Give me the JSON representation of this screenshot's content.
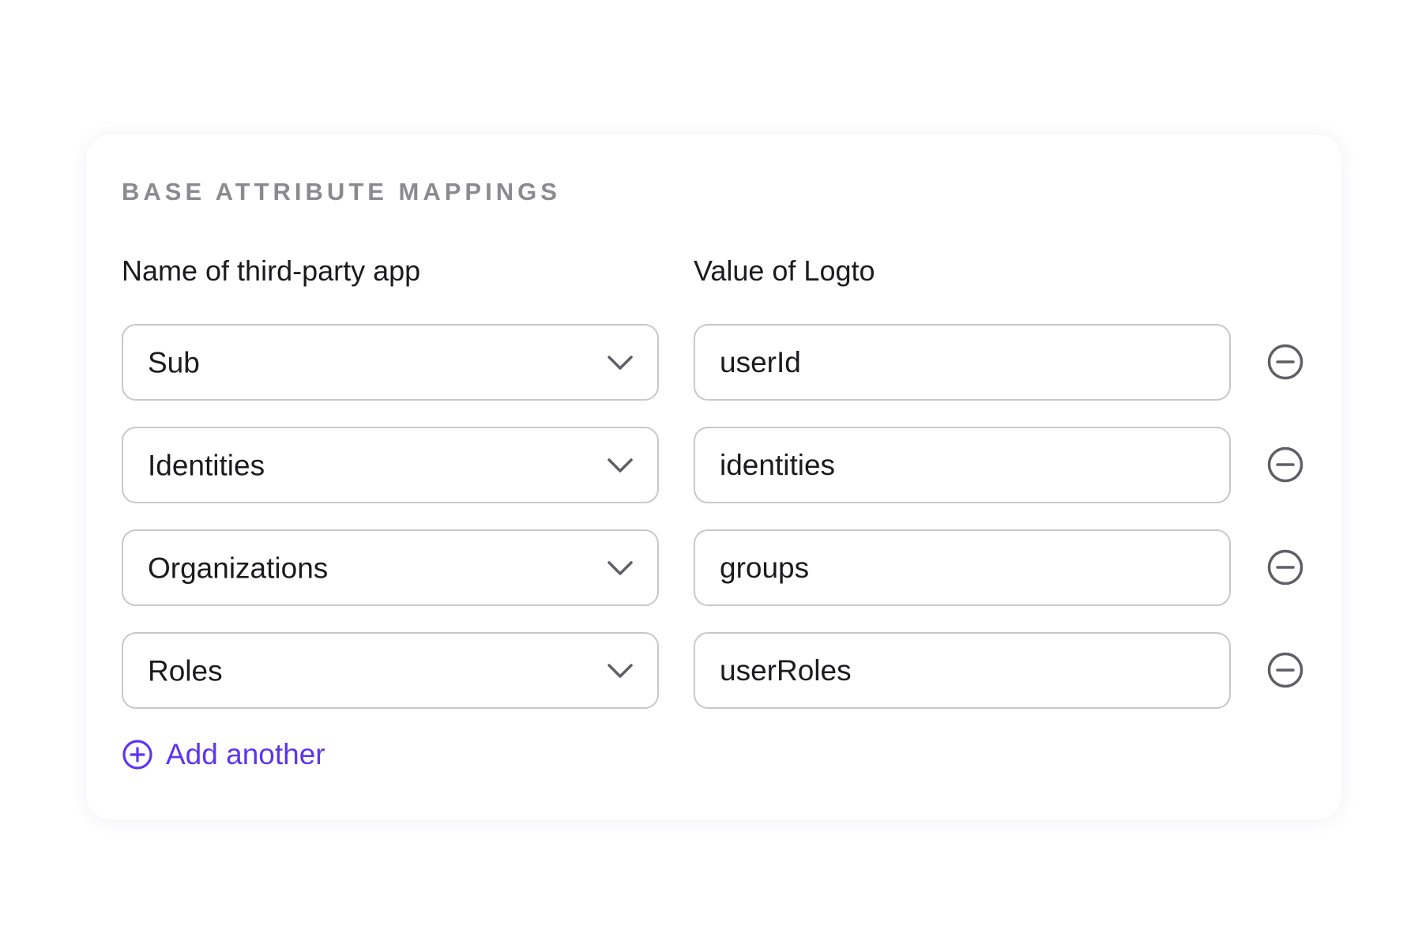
{
  "section": {
    "title": "BASE ATTRIBUTE MAPPINGS"
  },
  "columns": {
    "left_header": "Name of third-party app",
    "right_header": "Value of Logto"
  },
  "mappings": [
    {
      "third_party": "Sub",
      "logto_value": "userId"
    },
    {
      "third_party": "Identities",
      "logto_value": "identities"
    },
    {
      "third_party": "Organizations",
      "logto_value": "groups"
    },
    {
      "third_party": "Roles",
      "logto_value": "userRoles"
    }
  ],
  "actions": {
    "add_label": "Add another"
  },
  "icons": {
    "dropdown": "chevron-down-icon",
    "remove": "minus-circle-icon",
    "add": "plus-circle-icon"
  },
  "colors": {
    "accent": "#5d34f2",
    "border": "#c8c8cc",
    "section_title": "#8a8a8f",
    "text": "#1b1b1f",
    "icon": "#5f5f66"
  }
}
